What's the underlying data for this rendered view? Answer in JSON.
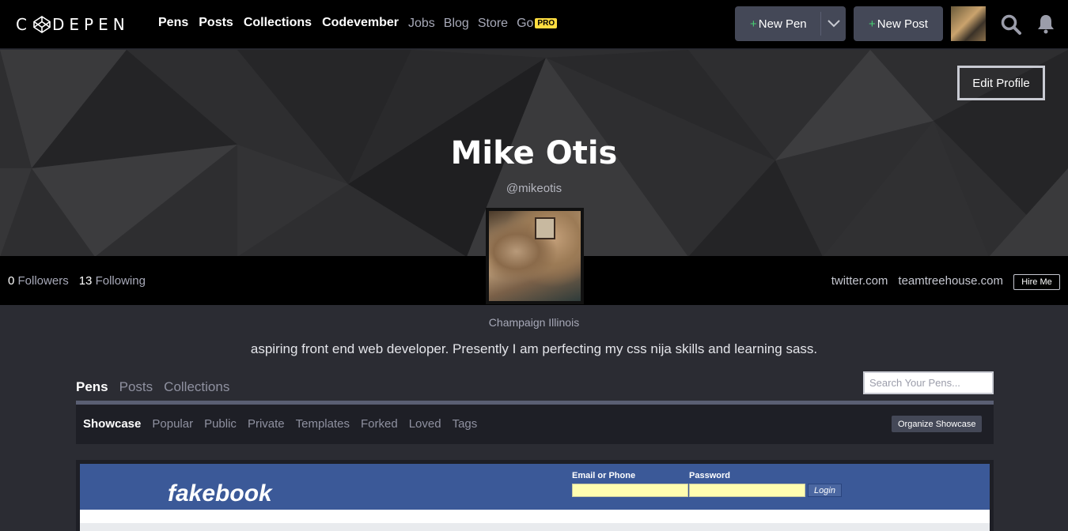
{
  "nav": {
    "logo": "CODEPEN",
    "main_links": [
      "Pens",
      "Posts",
      "Collections",
      "Codevember"
    ],
    "sub_links": [
      "Jobs",
      "Blog",
      "Store",
      "Go"
    ],
    "pro_badge": "PRO",
    "new_pen": "New Pen",
    "new_post": "New Post",
    "plus": "+",
    "icons": [
      "search-icon",
      "bell-icon",
      "chevron-down-icon"
    ]
  },
  "profile": {
    "edit_profile": "Edit Profile",
    "name": "Mike Otis",
    "handle": "@mikeotis",
    "followers_count": "0",
    "followers_label": "Followers",
    "following_count": "13",
    "following_label": "Following",
    "links": [
      "twitter.com",
      "teamtreehouse.com"
    ],
    "hire_me": "Hire Me",
    "location": "Champaign Illinois",
    "bio": "aspiring front end web developer. Presently I am perfecting my css nija skills and learning sass."
  },
  "tabs": {
    "items": [
      "Pens",
      "Posts",
      "Collections"
    ],
    "active": "Pens",
    "search_placeholder": "Search Your Pens..."
  },
  "subtabs": {
    "items": [
      "Showcase",
      "Popular",
      "Public",
      "Private",
      "Templates",
      "Forked",
      "Loved",
      "Tags"
    ],
    "active": "Showcase",
    "organize": "Organize Showcase"
  },
  "pen_preview": {
    "logo": "fakebook",
    "email_label": "Email or Phone",
    "password_label": "Password",
    "login": "Login"
  },
  "colors": {
    "nav_bg": "#000000",
    "page_bg": "#2b2c33",
    "accent_plus": "#47cf73",
    "pro_badge": "#ffdd40",
    "fb_blue": "#3b5998"
  }
}
